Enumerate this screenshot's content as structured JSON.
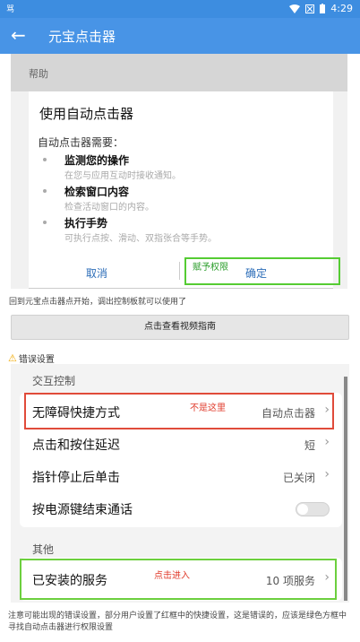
{
  "status_bar": {
    "left_icon": "sim-icon",
    "left_text": "骂",
    "time": "4:29"
  },
  "app_bar": {
    "back_icon": "arrow-left-icon",
    "title": "元宝点击器"
  },
  "help_screen": {
    "header": "帮助",
    "dialog_title": "使用自动点击器",
    "dialog_subtitle": "自动点击器需要：",
    "permissions": [
      {
        "title": "监测您的操作",
        "desc": "在您与应用互动时接收通知。"
      },
      {
        "title": "检索窗口内容",
        "desc": "检查活动窗口的内容。"
      },
      {
        "title": "执行手势",
        "desc": "可执行点按、滑动、双指张合等手势。"
      }
    ],
    "cancel_label": "取消",
    "ok_label": "确定",
    "grant_annotation": "赋予权限"
  },
  "instruction_text": "回到元宝点击器点开始，调出控制板就可以使用了",
  "video_button_label": "点击查看视频指南",
  "warning": {
    "icon": "warning-icon",
    "label": "错误设置"
  },
  "settings_screen": {
    "section_interaction": "交互控制",
    "rows": [
      {
        "label": "无障碍快捷方式",
        "value": "自动点击器"
      },
      {
        "label": "点击和按住延迟",
        "value": "短"
      },
      {
        "label": "指针停止后单击",
        "value": "已关闭"
      },
      {
        "label": "按电源键结束通话",
        "value": ""
      }
    ],
    "wrong_annotation": "不是这里",
    "section_other": "其他",
    "installed_services": {
      "label": "已安装的服务",
      "value": "10 项服务"
    },
    "enter_annotation": "点击进入"
  },
  "footer_note": "注意可能出现的错误设置，部分用户设置了红框中的快捷设置，这是错误的，应该是绿色方框中寻找自动点击器进行权限设置",
  "colors": {
    "appbar": "#4894e6",
    "red_box": "#e04b3a",
    "green_box": "#55cc33"
  }
}
